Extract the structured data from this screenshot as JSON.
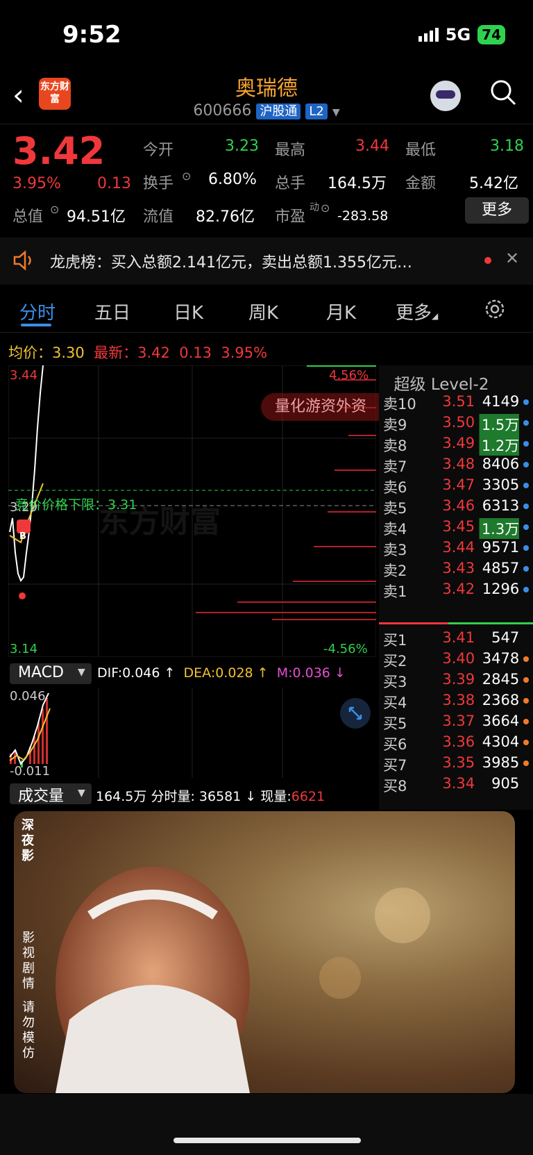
{
  "status": {
    "time": "9:52",
    "network": "5G",
    "battery": "74"
  },
  "header": {
    "title": "奥瑞德",
    "code": "600666",
    "tag1": "沪股通",
    "tag2": "L2",
    "logo": "东方财富"
  },
  "quote": {
    "price": "3.42",
    "pct": "3.95%",
    "change": "0.13",
    "open_label": "今开",
    "open": "3.23",
    "high_label": "最高",
    "high": "3.44",
    "low_label": "最低",
    "low": "3.18",
    "turnover_label": "换手",
    "turnover": "6.80%",
    "volume_label": "总手",
    "volume": "164.5万",
    "amount_label": "金额",
    "amount": "5.42亿",
    "mktcap_label": "总值",
    "mktcap": "94.51亿",
    "float_label": "流值",
    "float": "82.76亿",
    "pe_label": "市盈",
    "pe_sup": "动",
    "pe": "-283.58",
    "more": "更多"
  },
  "notice": {
    "text": "龙虎榜：买入总额2.141亿元，卖出总额1.355亿元…"
  },
  "tabs": [
    "分时",
    "五日",
    "日K",
    "周K",
    "月K",
    "更多"
  ],
  "avg": {
    "label": "均价：",
    "value": "3.30",
    "latest_label": "最新：",
    "latest": "3.42",
    "change": "0.13",
    "pct": "3.95%"
  },
  "chart": {
    "top_price": "3.44",
    "bottom_price": "3.14",
    "top_pct": "4.56%",
    "bottom_pct": "-4.56%",
    "mid_price": "3.29",
    "limit_text": "竞价价格下限：3.31",
    "banner": "量化游资外资",
    "watermark": "东方财富",
    "b_marker": "B"
  },
  "level2": {
    "title": "超级 Level-2",
    "sells": [
      {
        "label": "卖10",
        "price": "3.51",
        "vol": "4149",
        "dot": "#3a8ee8"
      },
      {
        "label": "卖9",
        "price": "3.50",
        "vol": "1.5万",
        "dot": "#3a8ee8"
      },
      {
        "label": "卖8",
        "price": "3.49",
        "vol": "1.2万",
        "dot": "#3a8ee8"
      },
      {
        "label": "卖7",
        "price": "3.48",
        "vol": "8406",
        "dot": "#3a8ee8"
      },
      {
        "label": "卖6",
        "price": "3.47",
        "vol": "3305",
        "dot": "#3a8ee8"
      },
      {
        "label": "卖5",
        "price": "3.46",
        "vol": "6313",
        "dot": "#3a8ee8"
      },
      {
        "label": "卖4",
        "price": "3.45",
        "vol": "1.3万",
        "dot": "#3a8ee8"
      },
      {
        "label": "卖3",
        "price": "3.44",
        "vol": "9571",
        "dot": "#3a8ee8"
      },
      {
        "label": "卖2",
        "price": "3.43",
        "vol": "4857",
        "dot": "#3a8ee8"
      },
      {
        "label": "卖1",
        "price": "3.42",
        "vol": "1296",
        "dot": "#3a8ee8"
      }
    ],
    "buys": [
      {
        "label": "买1",
        "price": "3.41",
        "vol": "547",
        "dot": ""
      },
      {
        "label": "买2",
        "price": "3.40",
        "vol": "3478",
        "dot": "#f07a2a"
      },
      {
        "label": "买3",
        "price": "3.39",
        "vol": "2845",
        "dot": "#f07a2a"
      },
      {
        "label": "买4",
        "price": "3.38",
        "vol": "2368",
        "dot": "#f07a2a"
      },
      {
        "label": "买5",
        "price": "3.37",
        "vol": "3664",
        "dot": "#f07a2a"
      },
      {
        "label": "买6",
        "price": "3.36",
        "vol": "4304",
        "dot": "#f07a2a"
      },
      {
        "label": "买7",
        "price": "3.35",
        "vol": "3985",
        "dot": "#f07a2a"
      },
      {
        "label": "买8",
        "price": "3.34",
        "vol": "905",
        "dot": ""
      }
    ]
  },
  "macd": {
    "name": "MACD",
    "dif": "DIF:0.046 ↑",
    "dea": "DEA:0.028 ↑",
    "m": "M:0.036 ↓",
    "top": "0.046",
    "bottom": "-0.011"
  },
  "volume": {
    "name": "成交量",
    "total": "164.5万",
    "min_vol": "分时量: 36581 ↓",
    "now_label": "现量:",
    "now": "6621"
  },
  "video": {
    "logo": "深夜影",
    "vert1": "影视剧情",
    "vert2": "请勿模仿"
  }
}
